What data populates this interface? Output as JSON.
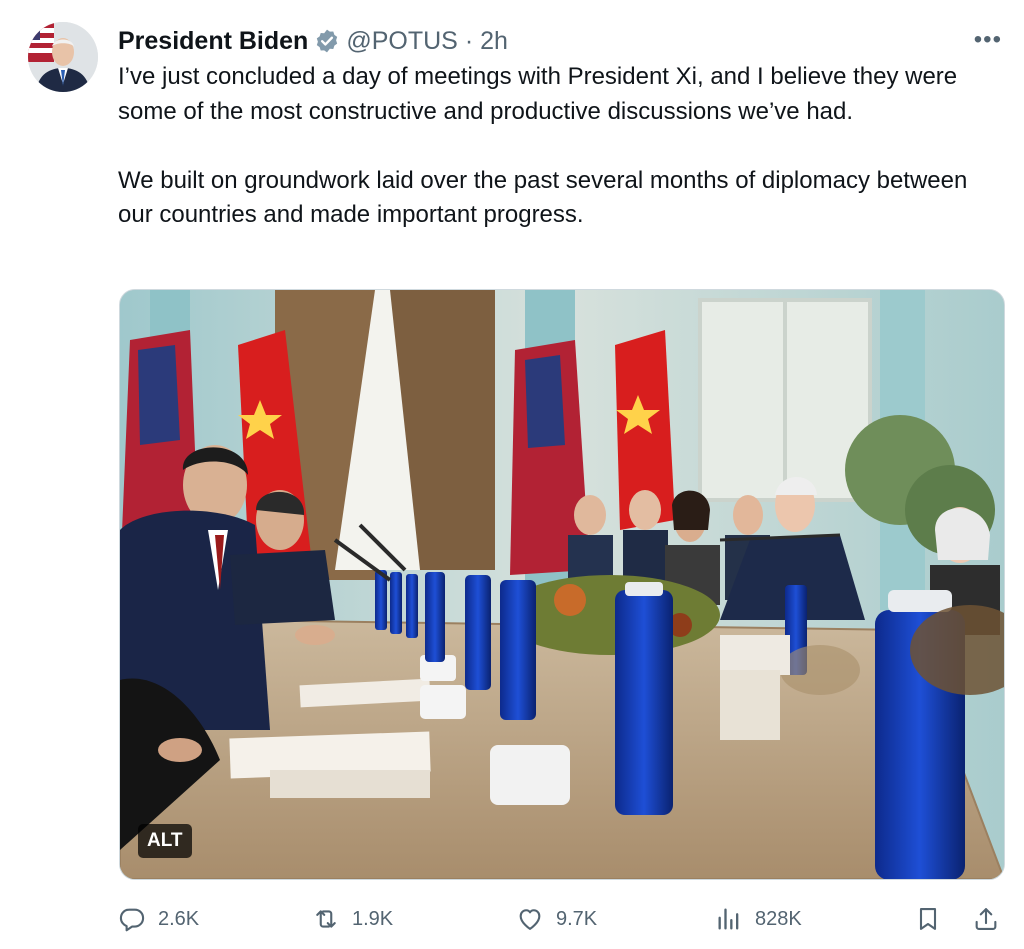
{
  "tweet": {
    "author_name": "President Biden",
    "handle": "@POTUS",
    "separator": "·",
    "time": "2h",
    "more_label": "•••",
    "paragraphs": [
      "I’ve just concluded a day of meetings with President Xi, and I believe they were some of the most constructive and productive discussions we’ve had.",
      "We built on groundwork laid over the past several months of diplomacy between our countries and made important progress."
    ],
    "media_alt_badge": "ALT"
  },
  "actions": {
    "replies": "2.6K",
    "retweets": "1.9K",
    "likes": "9.7K",
    "views": "828K"
  },
  "icons": {
    "verified": "verified-badge-icon",
    "more": "more-options-icon",
    "reply": "reply-icon",
    "retweet": "retweet-icon",
    "like": "heart-icon",
    "views": "views-icon",
    "bookmark": "bookmark-icon",
    "share": "share-icon"
  },
  "colors": {
    "text": "#0f1419",
    "secondary": "#536471",
    "verified": "#829aab"
  }
}
